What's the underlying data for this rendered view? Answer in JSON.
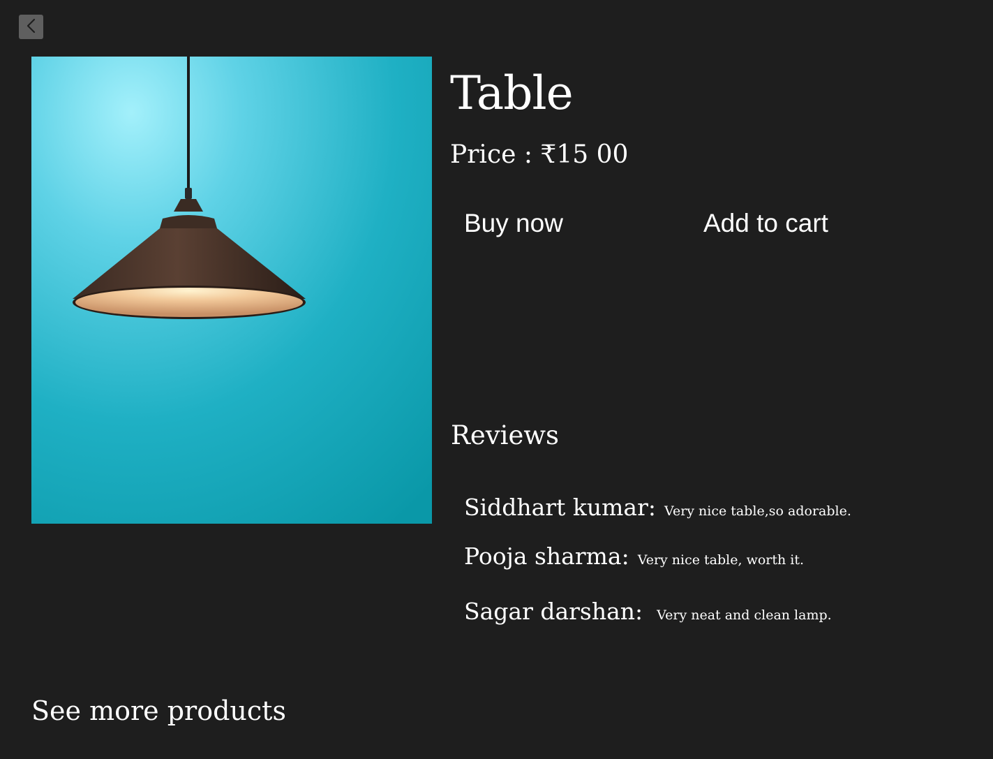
{
  "nav": {
    "back_icon": "chevron-left-icon"
  },
  "product": {
    "title": "Table",
    "price": "Price : ₹15 00",
    "image_icon": "pendant-lamp-photo"
  },
  "actions": {
    "buy_label": "Buy now",
    "cart_label": "Add to cart"
  },
  "reviews": {
    "heading": "Reviews",
    "items": [
      {
        "name": "Siddhart kumar:",
        "text": "Very nice table,so adorable."
      },
      {
        "name": "Pooja sharma:",
        "text": "Very nice table, worth it."
      },
      {
        "name": "Sagar darshan:",
        "text": "Very neat and clean lamp."
      }
    ]
  },
  "footer": {
    "see_more_label": "See more products"
  },
  "colors": {
    "background": "#1e1e1e",
    "text": "#ffffff",
    "back_button": "#5f5f5f",
    "image_bg": "#2fb8cc"
  }
}
